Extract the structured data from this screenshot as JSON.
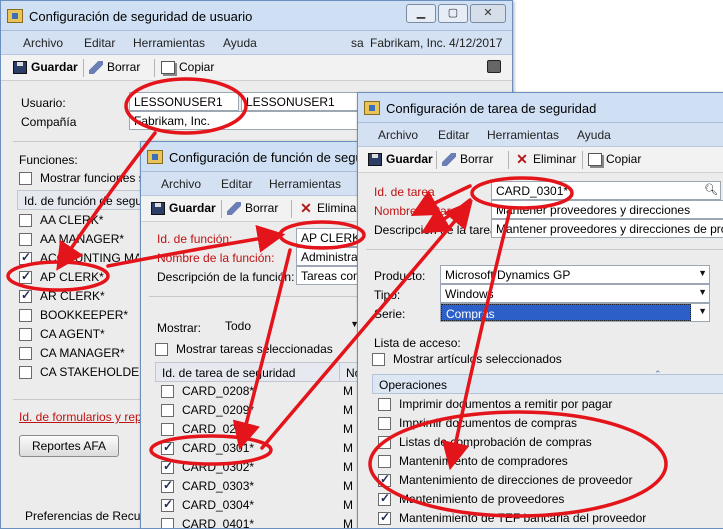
{
  "win_user": {
    "title": "Configuración de seguridad de usuario",
    "menu": [
      "Archivo",
      "Editar",
      "Herramientas",
      "Ayuda"
    ],
    "status": {
      "prefix": "sa",
      "company": "Fabrikam, Inc.",
      "date": "4/12/2017"
    },
    "toolbar": {
      "save": "Guardar",
      "clear": "Borrar",
      "copy": "Copiar"
    },
    "usuario_label": "Usuario:",
    "usuario_value": "LESSONUSER1",
    "usuario_name": "LESSONUSER1",
    "compania_label": "Compañía",
    "compania_value": "Fabrikam, Inc.",
    "funciones_label": "Funciones:",
    "show_selected": "Mostrar funciones sel",
    "list_header": "Id. de función de segur",
    "roles": [
      {
        "name": "AA CLERK*",
        "checked": false
      },
      {
        "name": "AA MANAGER*",
        "checked": false
      },
      {
        "name": "ACCOUNTING MA",
        "checked": true
      },
      {
        "name": "AP CLERK*",
        "checked": true
      },
      {
        "name": "AR CLERK*",
        "checked": true
      },
      {
        "name": "BOOKKEEPER*",
        "checked": false
      },
      {
        "name": "CA AGENT*",
        "checked": false
      },
      {
        "name": "CA MANAGER*",
        "checked": false
      },
      {
        "name": "CA STAKEHOLDER",
        "checked": false
      }
    ],
    "forms_link": "Id. de formularios y report",
    "afa_button": "Reportes AFA",
    "bottom_text": "Preferencias de Recur"
  },
  "win_role": {
    "title": "Configuración de función de seguri",
    "menu": [
      "Archivo",
      "Editar",
      "Herramientas"
    ],
    "toolbar": {
      "save": "Guardar",
      "clear": "Borrar",
      "delete": "Elimina"
    },
    "id_label": "Id. de función:",
    "id_value": "AP CLERK*",
    "name_label": "Nombre de la función:",
    "name_value": "Administrati",
    "desc_label": "Descripción de la función:",
    "desc_value": "Tareas comp",
    "mostrar_label": "Mostrar:",
    "mostrar_value": "Todo",
    "show_selected": "Mostrar tareas seleccionadas",
    "list_header": "Id. de tarea de seguridad",
    "list_header2": "No",
    "tasks": [
      {
        "name": "CARD_0208*",
        "checked": false,
        "col": "M"
      },
      {
        "name": "CARD_0209*",
        "checked": false,
        "col": "M"
      },
      {
        "name": "CARD_0210",
        "checked": false,
        "col": "M"
      },
      {
        "name": "CARD_0301*",
        "checked": true,
        "col": "M"
      },
      {
        "name": "CARD_0302*",
        "checked": true,
        "col": "M"
      },
      {
        "name": "CARD_0303*",
        "checked": true,
        "col": "M"
      },
      {
        "name": "CARD_0304*",
        "checked": true,
        "col": "M"
      },
      {
        "name": "CARD_0401*",
        "checked": false,
        "col": "M"
      }
    ]
  },
  "win_task": {
    "title": "Configuración de tarea de seguridad",
    "menu": [
      "Archivo",
      "Editar",
      "Herramientas",
      "Ayuda"
    ],
    "toolbar": {
      "save": "Guardar",
      "clear": "Borrar",
      "delete": "Eliminar",
      "copy": "Copiar"
    },
    "id_label": "Id. de tarea",
    "id_value": "CARD_0301*",
    "name_label": "Nombre de tarea",
    "name_value": "Mantener proveedores y direcciones",
    "desc_label": "Descripción de la tarea",
    "desc_value": "Mantener proveedores y direcciones de proveed",
    "product_label": "Producto:",
    "product_value": "Microsoft Dynamics GP",
    "type_label": "Tipo:",
    "type_value": "Windows",
    "series_label": "Serie:",
    "series_value": "Compras",
    "access_label": "Lista de acceso:",
    "show_selected": "Mostrar artículos seleccionados",
    "group_header": "Operaciones",
    "operations": [
      {
        "name": "Imprimir documentos a remitir por pagar",
        "checked": false
      },
      {
        "name": "Imprimir documentos de compras",
        "checked": false
      },
      {
        "name": "Listas de comprobación de compras",
        "checked": false
      },
      {
        "name": "Mantenimiento de compradores",
        "checked": false
      },
      {
        "name": "Mantenimiento de direcciones de proveedor",
        "checked": true
      },
      {
        "name": "Mantenimiento de proveedores",
        "checked": true
      },
      {
        "name": "Mantenimiento de TEF bancaria del proveedor",
        "checked": true
      }
    ]
  },
  "annotation_color": "#e4141b"
}
